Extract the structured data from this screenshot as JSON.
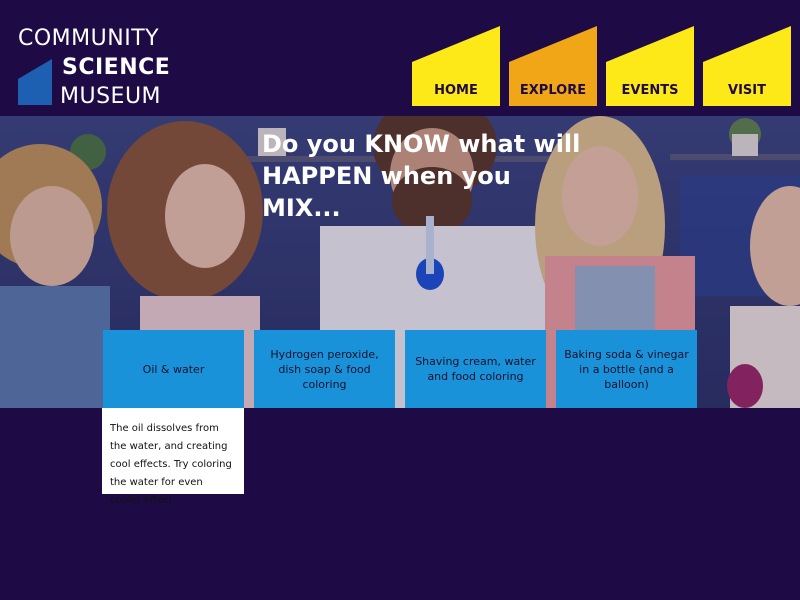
{
  "logo": {
    "line1": "COMMUNITY",
    "line2": "SCIENCE",
    "line3": "MUSEUM"
  },
  "nav": {
    "items": [
      {
        "label": "HOME",
        "color": "#fde918",
        "active": false
      },
      {
        "label": "EXPLORE",
        "color": "#f1a617",
        "active": true
      },
      {
        "label": "EVENTS",
        "color": "#fde918",
        "active": false
      },
      {
        "label": "VISIT",
        "color": "#fde918",
        "active": false
      }
    ]
  },
  "hero": {
    "headline": "Do you KNOW what will HAPPEN when you MIX..."
  },
  "experiments": [
    {
      "label": "Oil & water",
      "expanded": true,
      "detail": "The oil dissolves from the water, and creating cool effects. Try coloring the water for even cooler effect."
    },
    {
      "label": "Hydrogen peroxide, dish soap & food coloring"
    },
    {
      "label": "Shaving cream, water and food coloring"
    },
    {
      "label": "Baking soda & vinegar in a bottle (and a balloon)"
    }
  ],
  "colors": {
    "background": "#1e0b45",
    "card": "#1a92d9",
    "nav_yellow": "#fde918",
    "nav_orange": "#f1a617"
  }
}
